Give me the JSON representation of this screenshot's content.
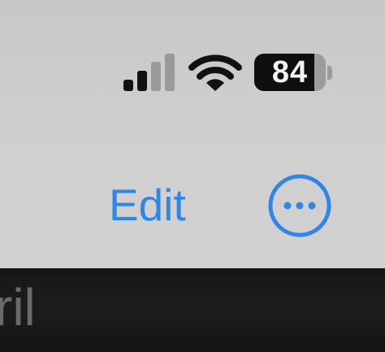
{
  "status_bar": {
    "signal_icon": "cellular-signal-icon",
    "signal_strength_bars": 2,
    "signal_total_bars": 4,
    "wifi_icon": "wifi-icon",
    "battery_icon": "battery-icon",
    "battery_level": "84",
    "battery_fraction": 0.84
  },
  "nav": {
    "edit_label": "Edit",
    "more_icon": "ellipsis-circle-icon"
  },
  "content": {
    "partial_title": "ril"
  },
  "colors": {
    "accent": "#2f86e6",
    "background": "#cfcfcf",
    "dark_strip": "#171717",
    "icon": "#111111",
    "inactive_icon": "#9a9a9a"
  }
}
